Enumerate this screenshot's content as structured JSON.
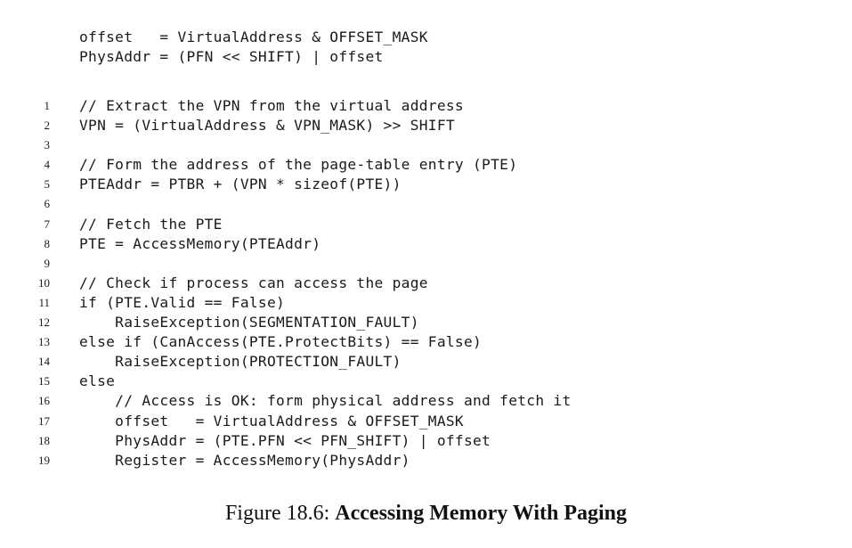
{
  "preamble": [
    "offset   = VirtualAddress & OFFSET_MASK",
    "PhysAddr = (PFN << SHIFT) | offset"
  ],
  "listing": [
    {
      "no": "1",
      "code": "// Extract the VPN from the virtual address"
    },
    {
      "no": "2",
      "code": "VPN = (VirtualAddress & VPN_MASK) >> SHIFT"
    },
    {
      "no": "3",
      "code": ""
    },
    {
      "no": "4",
      "code": "// Form the address of the page-table entry (PTE)"
    },
    {
      "no": "5",
      "code": "PTEAddr = PTBR + (VPN * sizeof(PTE))"
    },
    {
      "no": "6",
      "code": ""
    },
    {
      "no": "7",
      "code": "// Fetch the PTE"
    },
    {
      "no": "8",
      "code": "PTE = AccessMemory(PTEAddr)"
    },
    {
      "no": "9",
      "code": ""
    },
    {
      "no": "10",
      "code": "// Check if process can access the page"
    },
    {
      "no": "11",
      "code": "if (PTE.Valid == False)"
    },
    {
      "no": "12",
      "code": "    RaiseException(SEGMENTATION_FAULT)"
    },
    {
      "no": "13",
      "code": "else if (CanAccess(PTE.ProtectBits) == False)"
    },
    {
      "no": "14",
      "code": "    RaiseException(PROTECTION_FAULT)"
    },
    {
      "no": "15",
      "code": "else"
    },
    {
      "no": "16",
      "code": "    // Access is OK: form physical address and fetch it"
    },
    {
      "no": "17",
      "code": "    offset   = VirtualAddress & OFFSET_MASK"
    },
    {
      "no": "18",
      "code": "    PhysAddr = (PTE.PFN << PFN_SHIFT) | offset"
    },
    {
      "no": "19",
      "code": "    Register = AccessMemory(PhysAddr)"
    }
  ],
  "caption": {
    "label": "Figure 18.6: ",
    "title": "Accessing Memory With Paging"
  }
}
